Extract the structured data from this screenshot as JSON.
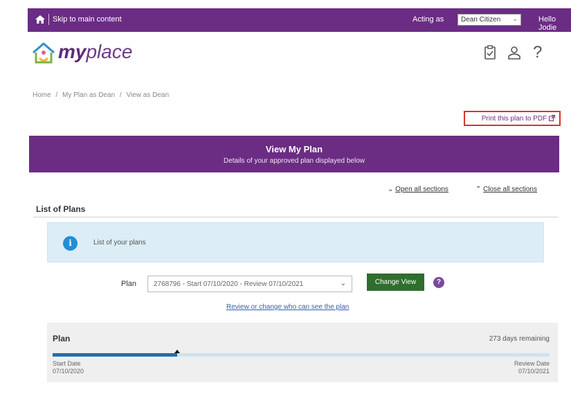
{
  "topbar": {
    "skip_link": "Skip to main content",
    "acting_label": "Acting as",
    "acting_value": "Dean Citizen",
    "greeting": "Hello Jodie"
  },
  "logo": {
    "my": "my",
    "place": "place"
  },
  "header_icons": [
    "checklist-icon",
    "user-icon",
    "help-icon"
  ],
  "header_help_glyph": "?",
  "breadcrumbs": [
    "Home",
    "/",
    "My Plan as Dean",
    "/",
    "View as Dean"
  ],
  "print_button": "Print this plan to PDF",
  "banner": {
    "title": "View My Plan",
    "subtitle": "Details of your approved plan displayed below"
  },
  "sections": {
    "open_all": "Open all sections",
    "close_all": "Close all sections"
  },
  "list_of_plans": {
    "title": "List of Plans",
    "info_text": "List of your plans"
  },
  "plan_select": {
    "label": "Plan",
    "value": "2768796 - Start 07/10/2020 - Review 07/10/2021",
    "change_button": "Change View",
    "help": "?"
  },
  "review_link": "Review or change who can see the plan",
  "plan_card": {
    "title": "Plan",
    "remaining": "273 days remaining",
    "progress_fraction": 0.25,
    "start_label": "Start Date",
    "start_date": "07/10/2020",
    "review_label": "Review Date",
    "review_date": "07/10/2021"
  },
  "colors": {
    "brand_purple": "#6b2c84",
    "highlight_red": "#d9342b",
    "button_green": "#2e6e2e",
    "progress_blue": "#1f6fb0",
    "info_bg": "#dcedf6"
  }
}
